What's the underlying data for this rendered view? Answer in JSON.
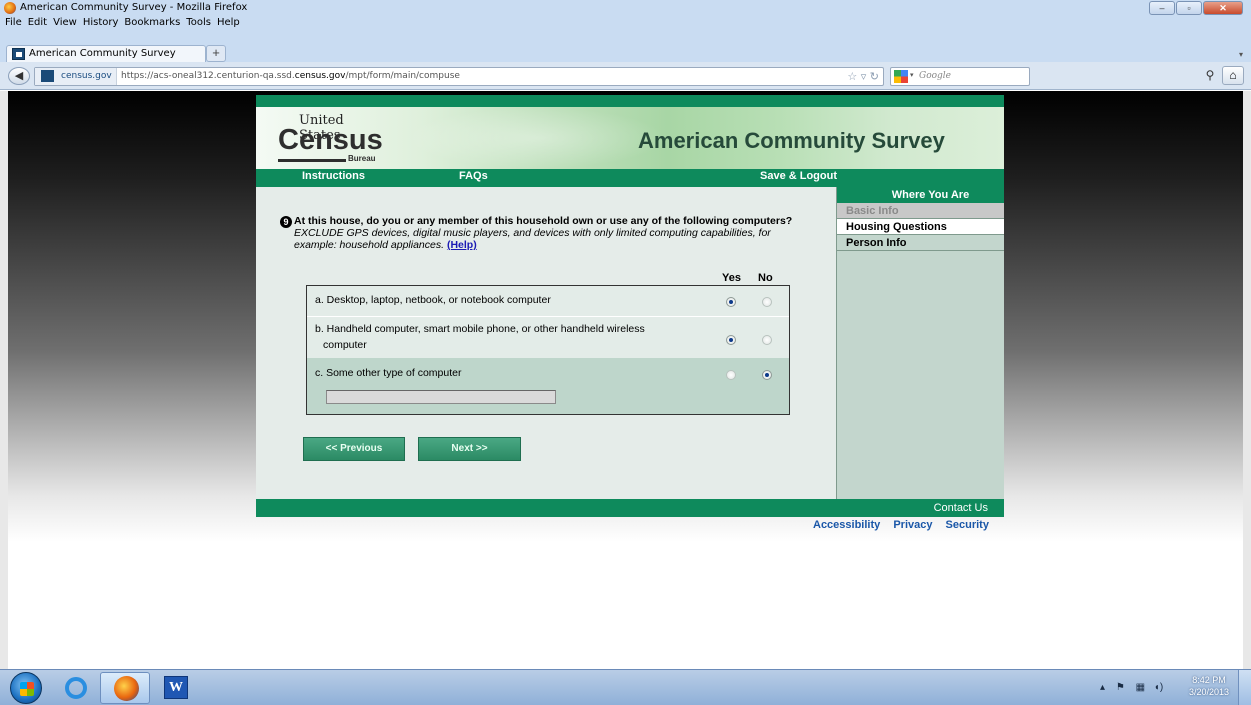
{
  "window": {
    "title": "American Community Survey - Mozilla Firefox",
    "controls": [
      "–",
      "▫",
      "✕"
    ]
  },
  "menu": [
    "File",
    "Edit",
    "View",
    "History",
    "Bookmarks",
    "Tools",
    "Help"
  ],
  "tab": {
    "label": "American Community Survey",
    "new_tab": "+"
  },
  "urlbar": {
    "identity": "census.gov",
    "url_prefix": "https://acs-oneal312.centurion-qa.ssd.",
    "url_domain": "census.gov",
    "url_path": "/mpt/form/main/compuse"
  },
  "search": {
    "placeholder": "Google"
  },
  "header": {
    "logo_top": "United States",
    "logo_main": "Census",
    "logo_bottom": "Bureau",
    "survey_title": "American Community Survey"
  },
  "nav": {
    "instructions": "Instructions",
    "faqs": "FAQs",
    "save_logout": "Save & Logout"
  },
  "sidebar": {
    "heading": "Where You Are",
    "items": [
      {
        "label": "Basic Info",
        "state": "disabled"
      },
      {
        "label": "Housing Questions",
        "state": "current"
      },
      {
        "label": "Person Info",
        "state": "normal"
      }
    ]
  },
  "question": {
    "number": "9",
    "bold_text": "At this house, do you or any member of this household own or use any of the following computers?",
    "italic_text": "EXCLUDE GPS devices, digital music players, and devices with only limited computing capabilities, for example: household appliances.",
    "help_link": "(Help)"
  },
  "columns": {
    "yes": "Yes",
    "no": "No"
  },
  "options": [
    {
      "label": "a. Desktop, laptop, netbook, or notebook computer",
      "answer": "yes"
    },
    {
      "label_line1": "b. Handheld computer, smart mobile phone, or other handheld wireless",
      "label_line2": "computer",
      "answer": "yes"
    },
    {
      "label": "c. Some other type of computer",
      "answer": "no",
      "specify_value": ""
    }
  ],
  "buttons": {
    "previous": "<<  Previous",
    "next": "Next  >>"
  },
  "footer": {
    "contact": "Contact Us",
    "links": [
      "Accessibility",
      "Privacy",
      "Security"
    ]
  },
  "taskbar": {
    "clock_time": "8:42 PM",
    "clock_date": "3/20/2013"
  }
}
